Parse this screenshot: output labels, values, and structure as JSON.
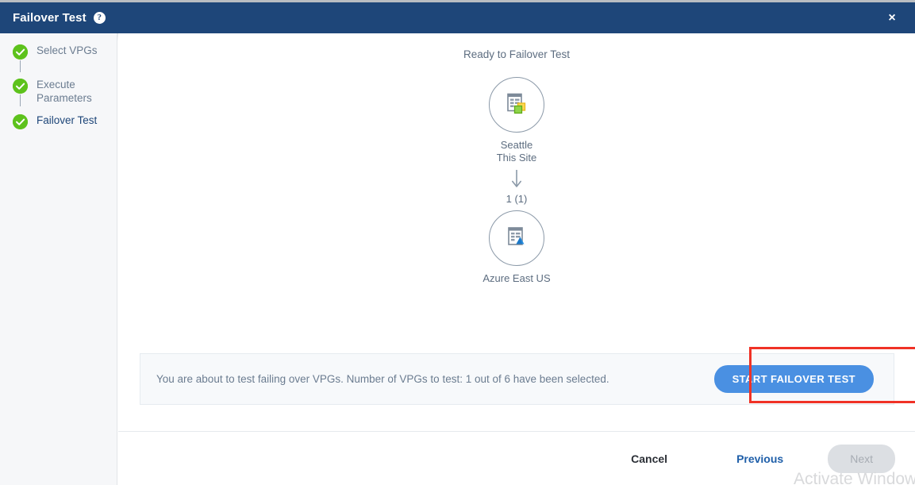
{
  "header": {
    "title": "Failover Test",
    "help_icon": "help-circle-icon",
    "help_glyph": "?",
    "close_icon": "close-icon",
    "close_glyph": "×",
    "background_color": "#1e4679"
  },
  "sidebar": {
    "steps": [
      {
        "label": "Select VPGs",
        "state": "complete",
        "icon": "check-circle-icon",
        "active": false
      },
      {
        "label": "Execute Parameters",
        "state": "complete",
        "icon": "check-circle-icon",
        "active": false
      },
      {
        "label": "Failover Test",
        "state": "complete",
        "icon": "check-circle-icon",
        "active": true
      }
    ],
    "complete_color": "#5dc21c"
  },
  "main": {
    "ready_title": "Ready to Failover Test",
    "topology": {
      "source": {
        "icon": "vpg-document-icon",
        "label_line1": "Seattle",
        "label_line2": "This Site"
      },
      "arrow_icon": "arrow-down-icon",
      "flow_count": "1 (1)",
      "target": {
        "icon": "azure-document-icon",
        "label_line1": "Azure East US"
      }
    },
    "notice": {
      "message": "You are about to test failing over VPGs. Number of VPGs to test: 1 out of 6 have been selected.",
      "start_button": "START FAILOVER TEST",
      "start_button_color": "#4a90e2"
    },
    "annotation": {
      "highlight_color": "#f03226",
      "target": "start-failover-test-button"
    }
  },
  "footer": {
    "cancel_label": "Cancel",
    "previous_label": "Previous",
    "next_label": "Next",
    "next_disabled": true
  },
  "watermark": {
    "text": "Activate Windows"
  }
}
